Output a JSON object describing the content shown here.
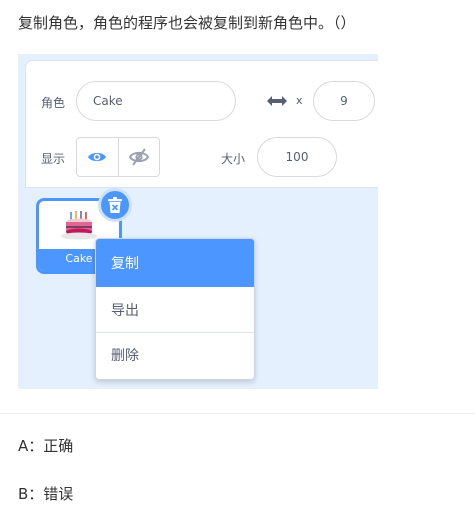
{
  "question": "复制角色，角色的程序也会被复制到新角色中。（）",
  "sprite_info": {
    "sprite_label": "角色",
    "sprite_name": "Cake",
    "x_label": "x",
    "x_value": "9",
    "show_label": "显示",
    "size_label": "大小",
    "size_value": "100"
  },
  "sprite_tile": {
    "name": "Cake"
  },
  "context_menu": {
    "items": [
      {
        "label": "复制",
        "active": true
      },
      {
        "label": "导出",
        "active": false
      },
      {
        "label": "删除",
        "active": false
      }
    ]
  },
  "options": [
    {
      "text": "A：正确"
    },
    {
      "text": "B：错误"
    }
  ],
  "colors": {
    "accent": "#4c97ff",
    "panel_bg": "#e5f0ff",
    "text": "#575e75"
  }
}
